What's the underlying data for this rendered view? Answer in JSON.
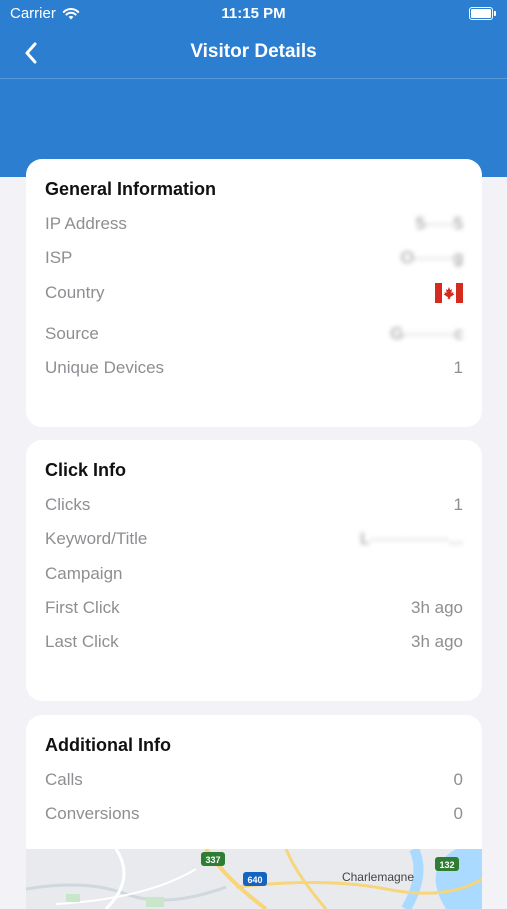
{
  "status_bar": {
    "carrier": "Carrier",
    "time": "11:15 PM"
  },
  "nav": {
    "title": "Visitor Details",
    "back_icon": "chevron-left-icon"
  },
  "general_info": {
    "title": "General Information",
    "rows": [
      {
        "label": "IP Address",
        "value": "5·····5"
      },
      {
        "label": "ISP",
        "value": "O·······g"
      },
      {
        "label": "Country",
        "value": "Canada flag"
      },
      {
        "label": "Source",
        "value": "G·········c"
      },
      {
        "label": "Unique Devices",
        "value": "1"
      }
    ]
  },
  "click_info": {
    "title": "Click Info",
    "rows": [
      {
        "label": "Clicks",
        "value": "1"
      },
      {
        "label": "Keyword/Title",
        "value": "L··············..."
      },
      {
        "label": "Campaign",
        "value": ""
      },
      {
        "label": "First Click",
        "value": "3h ago"
      },
      {
        "label": "Last Click",
        "value": "3h ago"
      }
    ]
  },
  "additional_info": {
    "title": "Additional Info",
    "rows": [
      {
        "label": "Calls",
        "value": "0"
      },
      {
        "label": "Conversions",
        "value": "0"
      }
    ]
  },
  "map": {
    "place_label": "Charlemagne",
    "routes": [
      "337",
      "640",
      "132"
    ]
  },
  "colors": {
    "header": "#2b7ed0",
    "background": "#f2f2f7",
    "label": "#8e8e93"
  }
}
